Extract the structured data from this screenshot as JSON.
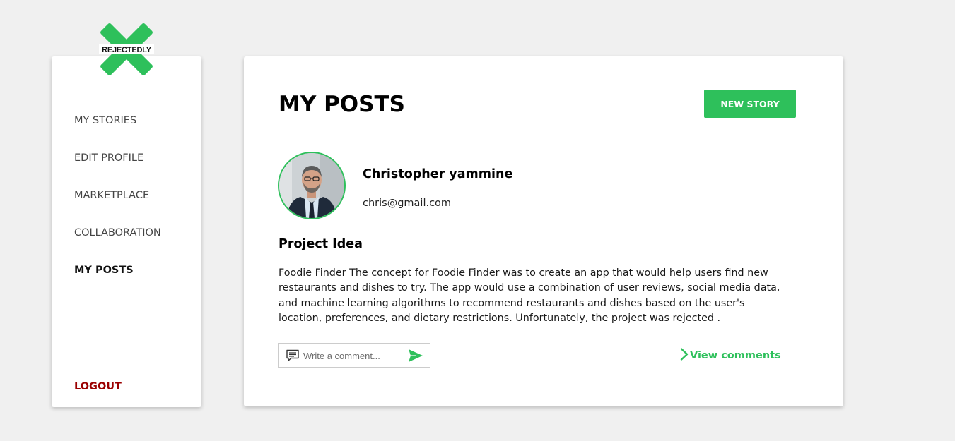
{
  "brand": {
    "name": "REJECTEDLY",
    "logo_icon": "x-mark-logo",
    "accent_color": "#2ec05b"
  },
  "sidebar": {
    "items": [
      {
        "label": "MY STORIES",
        "active": false
      },
      {
        "label": "EDIT PROFILE",
        "active": false
      },
      {
        "label": "MARKETPLACE",
        "active": false
      },
      {
        "label": "COLLABORATION",
        "active": false
      },
      {
        "label": "MY POSTS",
        "active": true
      }
    ],
    "logout_label": "LOGOUT",
    "logout_color": "#9b0000"
  },
  "main": {
    "title": "MY POSTS",
    "new_story_label": "NEW STORY"
  },
  "post": {
    "author": {
      "name": "Christopher yammine",
      "email": "chris@gmail.com",
      "avatar_icon": "profile-photo"
    },
    "title": "Project Idea",
    "body": "Foodie Finder The concept for Foodie Finder was to create an app that would help users find new restaurants and dishes to try. The app would use a combination of user reviews, social media data, and machine learning algorithms to recommend restaurants and dishes based on the user's location, preferences, and dietary restrictions. Unfortunately, the project was rejected .",
    "comment_placeholder": "Write a comment...",
    "comment_icon": "comment-icon",
    "send_icon": "send-icon",
    "view_comments_label": "View comments",
    "view_comments_icon": "chevron-right-icon"
  }
}
